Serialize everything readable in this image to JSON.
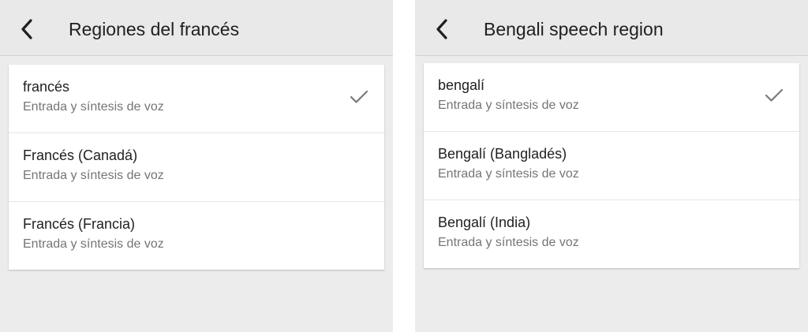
{
  "left_panel": {
    "title": "Regiones del francés",
    "back_icon": "chevron-left-icon",
    "items": [
      {
        "label": "francés",
        "subtitle": "Entrada y síntesis de voz",
        "selected": true
      },
      {
        "label": "Francés (Canadá)",
        "subtitle": "Entrada y síntesis de voz",
        "selected": false
      },
      {
        "label": "Francés (Francia)",
        "subtitle": "Entrada y síntesis de voz",
        "selected": false
      }
    ]
  },
  "right_panel": {
    "title": "Bengali speech region",
    "back_icon": "chevron-left-icon",
    "items": [
      {
        "label": "bengalí",
        "subtitle": "Entrada y síntesis de voz",
        "selected": true
      },
      {
        "label": "Bengalí (Bangladés)",
        "subtitle": "Entrada y síntesis de voz",
        "selected": false
      },
      {
        "label": "Bengalí (India)",
        "subtitle": "Entrada y síntesis de voz",
        "selected": false
      }
    ]
  },
  "colors": {
    "background": "#ececec",
    "card": "#ffffff",
    "title_text": "#202020",
    "subtitle_text": "#757575",
    "check": "#7a7a7a"
  }
}
